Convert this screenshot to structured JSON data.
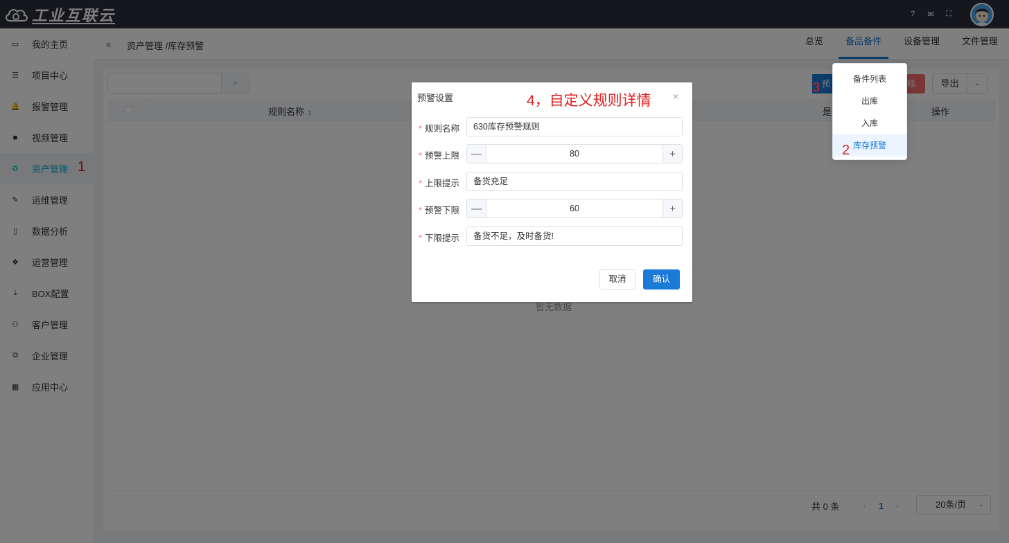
{
  "app": {
    "logo_text": "工业互联云"
  },
  "topbar": {
    "icons": [
      "help-icon",
      "mail-icon",
      "fullscreen-icon"
    ],
    "help_glyph": "?",
    "mail_glyph": "✉",
    "fullscreen_glyph": "⛶"
  },
  "sidebar": {
    "items": [
      {
        "label": "我的主页",
        "icon": "laptop-icon",
        "glyph": "▭"
      },
      {
        "label": "项目中心",
        "icon": "list-icon",
        "glyph": "☰"
      },
      {
        "label": "报警管理",
        "icon": "bell-icon",
        "glyph": "🔔"
      },
      {
        "label": "视频管理",
        "icon": "video-icon",
        "glyph": "■"
      },
      {
        "label": "资产管理",
        "icon": "recycle-icon",
        "glyph": "♻"
      },
      {
        "label": "运维管理",
        "icon": "wrench-icon",
        "glyph": "✎"
      },
      {
        "label": "数据分析",
        "icon": "map-icon",
        "glyph": "▯"
      },
      {
        "label": "运营管理",
        "icon": "cubes-icon",
        "glyph": "❖"
      },
      {
        "label": "BOX配置",
        "icon": "download-icon",
        "glyph": "⤓"
      },
      {
        "label": "客户管理",
        "icon": "users-icon",
        "glyph": "⚇"
      },
      {
        "label": "企业管理",
        "icon": "sitemap-icon",
        "glyph": "⧉"
      },
      {
        "label": "应用中心",
        "icon": "grid-icon",
        "glyph": "▦"
      }
    ],
    "active_index": 4,
    "annotation": "1"
  },
  "header": {
    "menu_glyph": "≡",
    "breadcrumb": "资产管理 /库存预警",
    "tabs": [
      "总览",
      "备品备件",
      "设备管理",
      "文件管理"
    ],
    "active_tab": 1
  },
  "dropdown": {
    "items": [
      "备件列表",
      "出库",
      "入库",
      "库存预警"
    ],
    "active_index": 3,
    "annotation": "2"
  },
  "toolbar": {
    "search_glyph": "⌕",
    "warn_btn_label": "预",
    "warn_annotation": "3",
    "delete_label": "除",
    "export_label": "导出",
    "export_caret": "⌄"
  },
  "table": {
    "columns": [
      "规则名称",
      "是",
      "操作"
    ],
    "sort_glyph": "⇕",
    "empty_text": "暂无数据"
  },
  "pagination": {
    "total": "共 0 条",
    "prev": "‹",
    "current": "1",
    "next": "›",
    "page_size": "20条/页",
    "size_caret": "⌄"
  },
  "dialog": {
    "title": "预警设置",
    "annotation": "4，自定义规则详情",
    "close_glyph": "×",
    "fields": {
      "rule_name": {
        "label": "规则名称",
        "value": "630库存预警规则"
      },
      "upper_limit": {
        "label": "预警上限",
        "value": "80"
      },
      "upper_hint": {
        "label": "上限提示",
        "value": "备货充足"
      },
      "lower_limit": {
        "label": "预警下限",
        "value": "60"
      },
      "lower_hint": {
        "label": "下限提示",
        "value": "备货不足，及时备货!"
      }
    },
    "required_mark": "*",
    "minus_glyph": "—",
    "plus_glyph": "+",
    "cancel_label": "取消",
    "confirm_label": "确认"
  },
  "colors": {
    "topbar": "#2b2f3a",
    "accent": "#1a7ad6",
    "sidebar_active": "#0ab0d8",
    "danger": "#f56c6c",
    "annotation": "#e02020"
  }
}
